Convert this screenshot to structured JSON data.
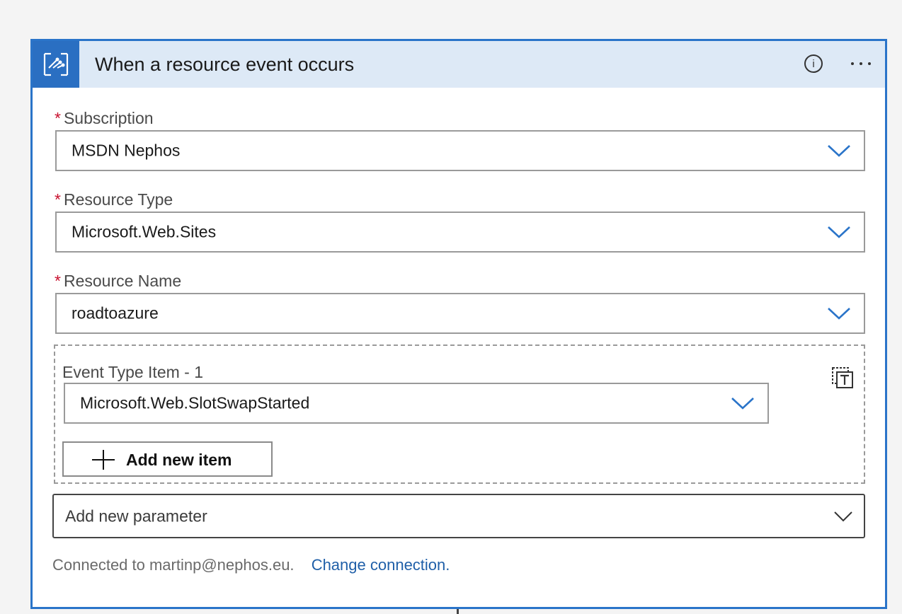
{
  "card": {
    "title": "When a resource event occurs",
    "icon": "event-grid-icon",
    "info_icon": "info-icon",
    "info_glyph": "i",
    "more_icon": "more-options-icon"
  },
  "fields": {
    "required_marker": "*",
    "subscription": {
      "label": "Subscription",
      "value": "MSDN Nephos"
    },
    "resource_type": {
      "label": "Resource Type",
      "value": "Microsoft.Web.Sites"
    },
    "resource_name": {
      "label": "Resource Name",
      "value": "roadtoazure"
    }
  },
  "event_types": {
    "item_label": "Event Type Item - 1",
    "item_value": "Microsoft.Web.SlotSwapStarted",
    "toggle_icon": "switch-to-text-mode-icon",
    "add_item_label": "Add new item"
  },
  "add_parameter": {
    "placeholder": "Add new parameter"
  },
  "footer": {
    "connected_text": "Connected to martinp@nephos.eu.",
    "change_link": "Change connection."
  },
  "colors": {
    "accent": "#2a74c9",
    "header_bg": "#dde9f6",
    "required": "#c8102e",
    "link": "#1f5fa8"
  }
}
